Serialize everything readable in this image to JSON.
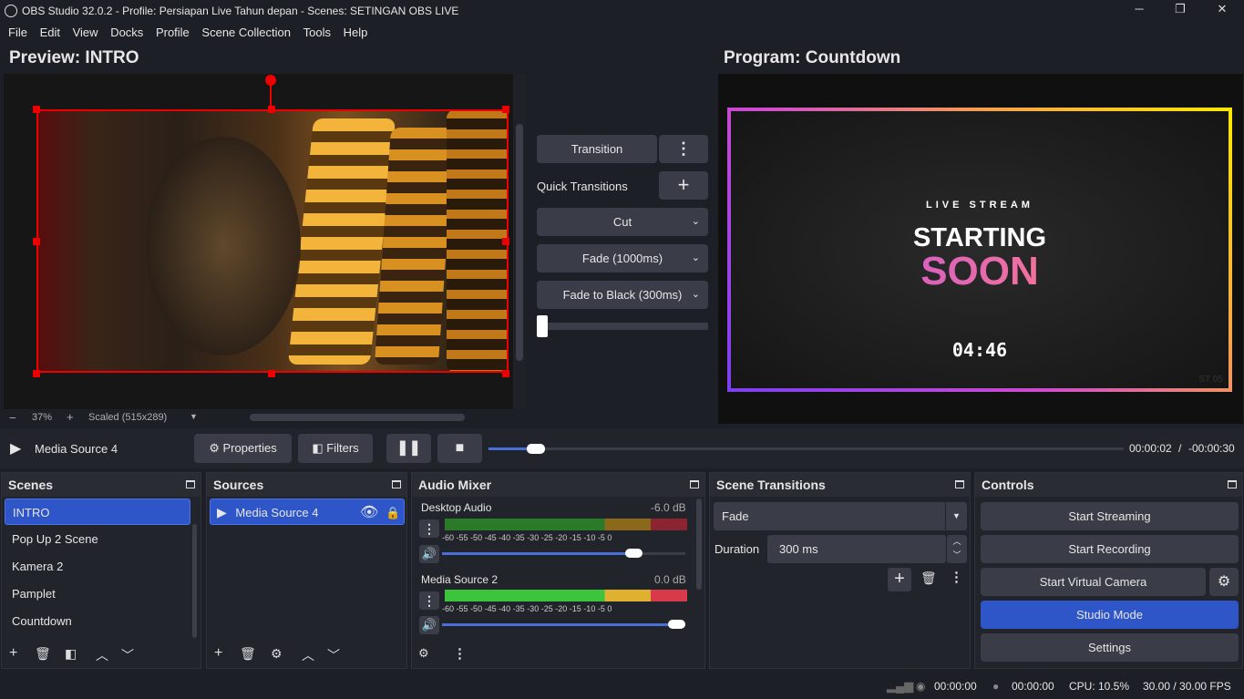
{
  "window": {
    "title": "OBS Studio 32.0.2 - Profile: Persiapan Live Tahun depan - Scenes: SETINGAN OBS LIVE",
    "minimize": "─",
    "maximize": "❐",
    "close": "✕"
  },
  "menu": [
    "File",
    "Edit",
    "View",
    "Docks",
    "Profile",
    "Scene Collection",
    "Tools",
    "Help"
  ],
  "preview": {
    "header": "Preview: INTRO",
    "zoom_minus": "−",
    "zoom": "37%",
    "zoom_plus": "+",
    "scaled": "Scaled (515x289)"
  },
  "program": {
    "header": "Program: Countdown",
    "live_stream": "LIVE STREAM",
    "starting": "STARTING",
    "soon": "SOON",
    "timer": "04:46",
    "watermark": "ST 05"
  },
  "transition_panel": {
    "transition_label": "Transition",
    "quick_transitions_label": "Quick Transitions",
    "cut": "Cut",
    "fade": "Fade (1000ms)",
    "fade_black": "Fade to Black (300ms)",
    "t_bar_position": 0
  },
  "media_controls": {
    "source_name": "Media Source 4",
    "properties": "Properties",
    "filters": "Filters",
    "time_current": "00:00:02",
    "separator": "/",
    "time_remaining": "-00:00:30",
    "progress": 0.075
  },
  "scenes": {
    "title": "Scenes",
    "items": [
      "INTRO",
      "Pop Up 2 Scene",
      "Kamera 2",
      "Pamplet",
      "Countdown"
    ],
    "selected": 0
  },
  "sources": {
    "title": "Sources",
    "items": [
      "Media Source 4"
    ]
  },
  "audio_mixer": {
    "title": "Audio Mixer",
    "channels": [
      {
        "name": "Desktop Audio",
        "db": "-6.0 dB",
        "volume": 0.79
      },
      {
        "name": "Media Source 2",
        "db": "0.0 dB",
        "volume": 1.0
      }
    ],
    "ticks": [
      "-60",
      "-55",
      "-50",
      "-45",
      "-40",
      "-35",
      "-30",
      "-25",
      "-20",
      "-15",
      "-10",
      "-5",
      "0"
    ]
  },
  "scene_transitions": {
    "title": "Scene Transitions",
    "selected": "Fade",
    "duration_label": "Duration",
    "duration_value": "300 ms"
  },
  "controls": {
    "title": "Controls",
    "start_streaming": "Start Streaming",
    "start_recording": "Start Recording",
    "start_virtual_camera": "Start Virtual Camera",
    "studio_mode": "Studio Mode",
    "settings": "Settings"
  },
  "status": {
    "stream_time": "00:00:00",
    "rec_time": "00:00:00",
    "cpu": "CPU: 10.5%",
    "fps": "30.00 / 30.00 FPS"
  },
  "colors": {
    "accent": "#2f56c9",
    "selection_red": "#e00000",
    "meter_green": "#3cc43c",
    "meter_yellow": "#e0b030",
    "meter_red": "#d83a4a"
  }
}
